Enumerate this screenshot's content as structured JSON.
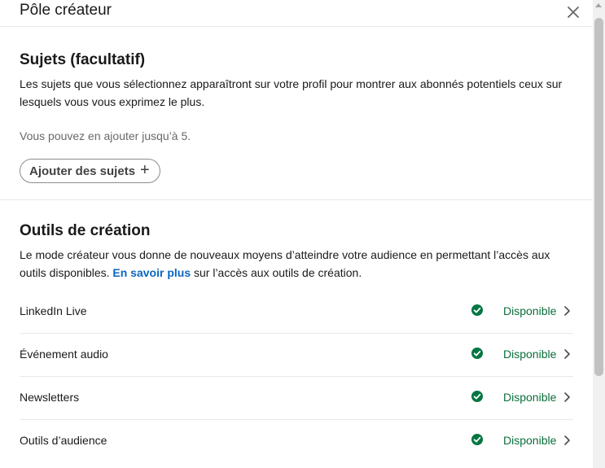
{
  "header": {
    "title": "Pôle créateur"
  },
  "topics": {
    "heading": "Sujets (facultatif)",
    "description": "Les sujets que vous sélectionnez apparaîtront sur votre profil pour montrer aux abonnés potentiels ceux sur lesquels vous vous exprimez le plus.",
    "limit_note": "Vous pouvez en ajouter jusqu’à 5.",
    "add_button_label": "Ajouter des sujets",
    "add_button_icon": "+"
  },
  "tools": {
    "heading": "Outils de création",
    "description_before_link": "Le mode créateur vous donne de nouveaux moyens d’atteindre votre audience en permettant l’accès aux outils disponibles. ",
    "link_label": "En savoir plus",
    "description_after_link": " sur l’accès aux outils de création.",
    "items": [
      {
        "name": "LinkedIn Live",
        "status": "Disponible"
      },
      {
        "name": "Événement audio",
        "status": "Disponible"
      },
      {
        "name": "Newsletters",
        "status": "Disponible"
      },
      {
        "name": "Outils d’audience",
        "status": "Disponible"
      }
    ]
  },
  "colors": {
    "accent_link": "#0a66c2",
    "status_green": "#0b6e3a",
    "check_green": "#057642"
  },
  "icons": {
    "close": "close-icon",
    "check": "check-circle-icon",
    "chevron": "chevron-right-icon"
  }
}
